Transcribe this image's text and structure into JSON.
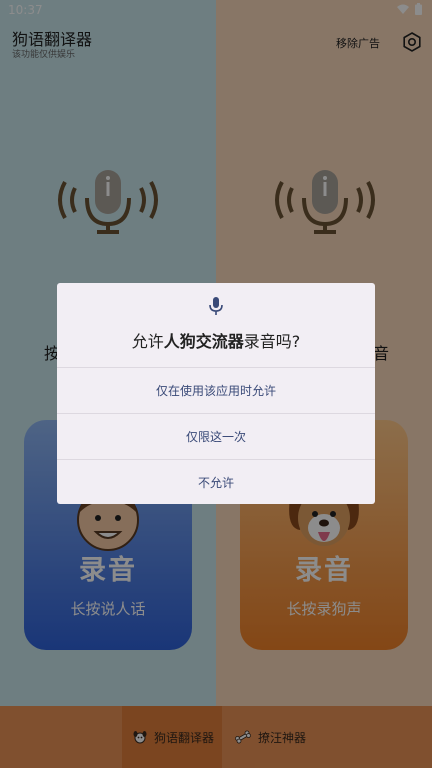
{
  "status": {
    "time": "10:37"
  },
  "header": {
    "title": "狗语翻译器",
    "subtitle": "该功能仅供娱乐",
    "remove_ads": "移除广告"
  },
  "panels": {
    "left": {
      "prompt_fragment": "按",
      "card_title": "录音",
      "card_subtitle": "长按说人话"
    },
    "right": {
      "prompt_fragment": "音",
      "card_title": "录音",
      "card_subtitle": "长按录狗声"
    }
  },
  "bottom_nav": {
    "tabs": [
      {
        "label": "狗语翻译器",
        "icon": "dog-icon",
        "active": true
      },
      {
        "label": "撩汪神器",
        "icon": "bone-icon",
        "active": false
      }
    ]
  },
  "dialog": {
    "title_prefix": "允许",
    "app_name": "人狗交流器",
    "title_suffix": "录音吗?",
    "buttons": [
      "仅在使用该应用时允许",
      "仅限这一次",
      "不允许"
    ]
  },
  "colors": {
    "left_bg": "#c8e6ec",
    "right_bg": "#f7d7ba",
    "left_card": "#2f62d9",
    "right_card": "#f08128",
    "nav": "#ea9356",
    "dialog_bg": "#f2eef4",
    "dialog_button_text": "#3a4a78"
  }
}
